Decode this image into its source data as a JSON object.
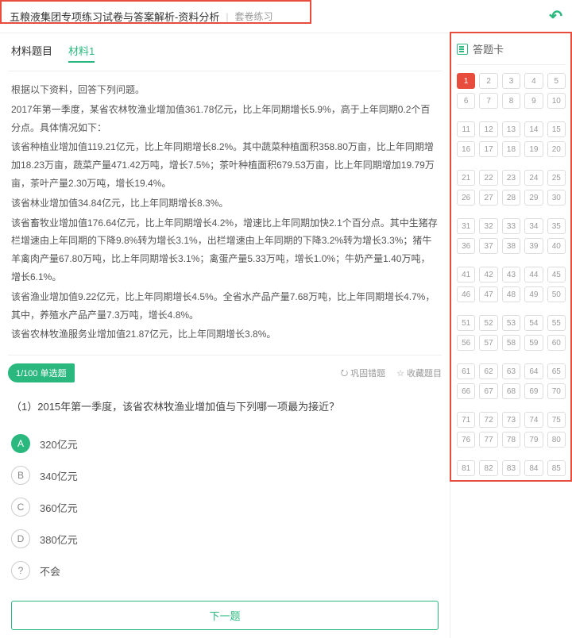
{
  "header": {
    "title": "五粮液集团专项练习试卷与答案解析-资料分析",
    "subtitle": "套卷练习"
  },
  "tabs": {
    "material_label": "材料题目",
    "material1": "材料1"
  },
  "passage": {
    "intro": "根据以下资料，回答下列问题。",
    "p1": "2017年第一季度，某省农林牧渔业增加值361.78亿元，比上年同期增长5.9%，高于上年同期0.2个百分点。具体情况如下：",
    "p2": "该省种植业增加值119.21亿元，比上年同期增长8.2%。其中蔬菜种植面积358.80万亩，比上年同期增加18.23万亩，蔬菜产量471.42万吨，增长7.5%；茶叶种植面积679.53万亩，比上年同期增加19.79万亩，茶叶产量2.30万吨，增长19.4%。",
    "p3": "该省林业增加值34.84亿元，比上年同期增长8.3%。",
    "p4": "该省畜牧业增加值176.64亿元，比上年同期增长4.2%，增速比上年同期加快2.1个百分点。其中生猪存栏增速由上年同期的下降9.8%转为增长3.1%，出栏增速由上年同期的下降3.2%转为增长3.3%；猪牛羊禽肉产量67.80万吨，比上年同期增长3.1%；禽蛋产量5.33万吨，增长1.0%；牛奶产量1.40万吨，增长6.1%。",
    "p5": "该省渔业增加值9.22亿元，比上年同期增长4.5%。全省水产品产量7.68万吨，比上年同期增长4.7%，其中，养殖水产品产量7.3万吨，增长4.8%。",
    "p6": "该省农林牧渔服务业增加值21.87亿元，比上年同期增长3.8%。"
  },
  "qbar": {
    "tag": "1/100 单选题",
    "consolidate": "巩固错题",
    "favorite": "收藏题目"
  },
  "question": {
    "text": "（1）2015年第一季度，该省农林牧渔业增加值与下列哪一项最为接近？"
  },
  "options": {
    "A": {
      "letter": "A",
      "text": "320亿元"
    },
    "B": {
      "letter": "B",
      "text": "340亿元"
    },
    "C": {
      "letter": "C",
      "text": "360亿元"
    },
    "D": {
      "letter": "D",
      "text": "380亿元"
    },
    "E": {
      "letter": "?",
      "text": "不会"
    }
  },
  "next_label": "下一题",
  "answer_card": {
    "title": "答题卡",
    "total": 100,
    "visible_max": 85,
    "current": 1
  }
}
